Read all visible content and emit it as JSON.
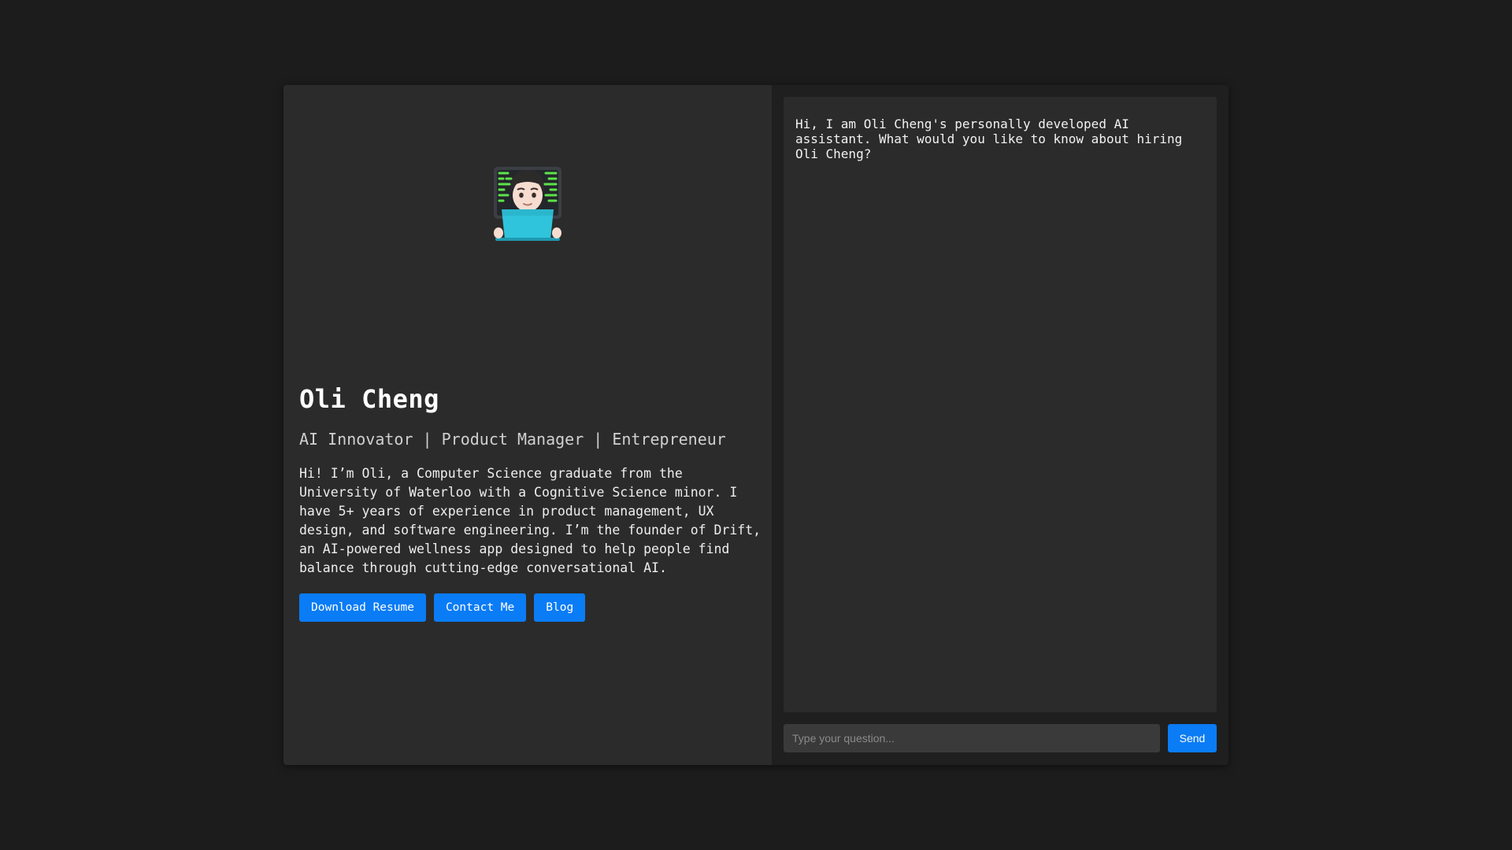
{
  "profile": {
    "avatar_icon": "technologist-emoji-icon",
    "name": "Oli Cheng",
    "tagline": "AI Innovator | Product Manager | Entrepreneur",
    "bio": "Hi! I’m Oli, a Computer Science graduate from the University of Waterloo with a Cognitive Science minor. I have 5+ years of experience in product management, UX design, and software engineering. I’m the founder of Drift, an AI-powered wellness app designed to help people find balance through cutting-edge conversational AI.",
    "actions": {
      "resume_label": "Download Resume",
      "contact_label": "Contact Me",
      "blog_label": "Blog"
    }
  },
  "chat": {
    "messages": [
      {
        "role": "assistant",
        "text": "Hi, I am Oli Cheng's personally developed AI\nassistant. What would you like to know about hiring\nOli Cheng?"
      }
    ],
    "input_placeholder": "Type your question...",
    "input_value": "",
    "send_label": "Send"
  },
  "colors": {
    "page_bg": "#1c1c1c",
    "panel_bg": "#2b2b2b",
    "accent": "#0a7cf5"
  }
}
